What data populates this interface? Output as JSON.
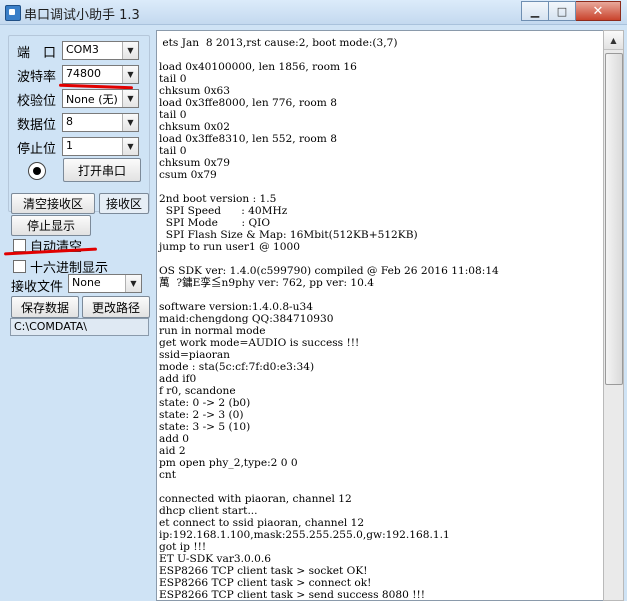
{
  "window": {
    "title": "串口调试小助手 1.3",
    "buttons": {
      "minimize": "▁",
      "maximize": "□",
      "close": "✕"
    }
  },
  "settings": {
    "port_label": "端　口",
    "port_value": "COM3",
    "baud_label": "波特率",
    "baud_value": "74800",
    "parity_label": "校验位",
    "parity_value": "None (无)",
    "databits_label": "数据位",
    "databits_value": "8",
    "stopbits_label": "停止位",
    "stopbits_value": "1",
    "open_port_button": "打开串口"
  },
  "receive": {
    "clear_button": "清空接收区",
    "area_label": "接收区",
    "stop_display_button": "停止显示",
    "auto_clear_label": "自动清空",
    "hex_display_label": "十六进制显示",
    "receive_file_label": "接收文件",
    "receive_file_value": "None",
    "save_data_button": "保存数据",
    "change_path_button": "更改路径",
    "path_value": "C:\\COMDATA\\"
  },
  "terminal": {
    "lines": [
      " ets Jan  8 2013,rst cause:2, boot mode:(3,7)",
      "",
      "load 0x40100000, len 1856, room 16",
      "tail 0",
      "chksum 0x63",
      "load 0x3ffe8000, len 776, room 8",
      "tail 0",
      "chksum 0x02",
      "load 0x3ffe8310, len 552, room 8",
      "tail 0",
      "chksum 0x79",
      "csum 0x79",
      "",
      "2nd boot version : 1.5",
      "  SPI Speed      : 40MHz",
      "  SPI Mode       : QIO",
      "  SPI Flash Size & Map: 16Mbit(512KB+512KB)",
      "jump to run user1 @ 1000",
      "",
      "OS SDK ver: 1.4.0(c599790) compiled @ Feb 26 2016 11:08:14",
      "萬  ?鏞E孪≦n9phy ver: 762, pp ver: 10.4",
      "",
      "software version:1.4.0.8-u34",
      "maid:chengdong QQ:384710930",
      "run in normal mode",
      "get work mode=AUDIO is success !!!",
      "ssid=piaoran",
      "mode : sta(5c:cf:7f:d0:e3:34)",
      "add if0",
      "f r0, scandone",
      "state: 0 -> 2 (b0)",
      "state: 2 -> 3 (0)",
      "state: 3 -> 5 (10)",
      "add 0",
      "aid 2",
      "pm open phy_2,type:2 0 0",
      "cnt",
      "",
      "connected with piaoran, channel 12",
      "dhcp client start...",
      "et connect to ssid piaoran, channel 12",
      "ip:192.168.1.100,mask:255.255.255.0,gw:192.168.1.1",
      "got ip !!!",
      "ET U-SDK var3.0.0.6",
      "ESP8266 TCP client task > socket OK!",
      "ESP8266 TCP client task > connect ok!",
      "ESP8266 TCP client task > send success 8080 !!!"
    ]
  },
  "colors": {
    "panel_bg": "#cfe3f5",
    "highlight_underline": "#e10000"
  },
  "icons": [
    "app-icon",
    "port-status-indicator",
    "dropdown-arrow-icon",
    "scroll-up-arrow-icon"
  ]
}
